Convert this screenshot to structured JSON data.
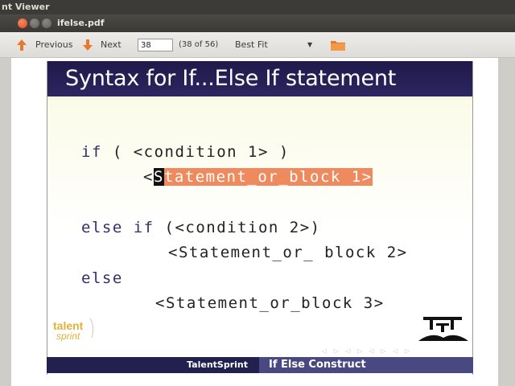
{
  "app_title": "nt Viewer",
  "window": {
    "title": "ifelse.pdf"
  },
  "toolbar": {
    "previous_label": "Previous",
    "next_label": "Next",
    "page_value": "38",
    "page_count": "(38 of 56)",
    "zoom_value": "Best Fit",
    "icons": {
      "previous": "arrow-up-icon",
      "next": "arrow-down-icon",
      "open": "folder-icon"
    },
    "accent_color": "#e8782e"
  },
  "slide": {
    "title": "Syntax for If...Else If statement",
    "code": {
      "line1_kw": "if",
      "line1_rest": " ( <condition 1> )",
      "line2_prefix": "<",
      "line2_cursor": "S",
      "line2_selected": "tatement_or_block 1>",
      "line3_kw": "else if",
      "line3_rest": " (<condition 2>)",
      "line4": "<Statement_or_ block 2>",
      "line5_kw": "else",
      "line6": "<Statement_or_block 3>"
    },
    "logo_left_text_1": "talent",
    "logo_left_text_2": "sprint",
    "nav_symbols": "◁ ▷ ◁ ▷ ◁ ▷ ◁ ▷",
    "footer_left": "TalentSprint",
    "footer_right": "If Else Construct",
    "colors": {
      "header": "#231e52",
      "highlight": "#ef8a5e",
      "footer": "#22204f"
    }
  }
}
